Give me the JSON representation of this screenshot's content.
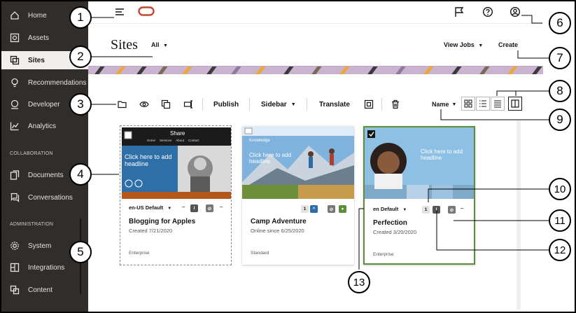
{
  "sidebar": {
    "items": [
      {
        "label": "Home",
        "icon": "home-icon"
      },
      {
        "label": "Assets",
        "icon": "assets-icon"
      },
      {
        "label": "Sites",
        "icon": "sites-icon"
      },
      {
        "label": "Recommendations",
        "icon": "lightbulb-icon"
      },
      {
        "label": "Developer",
        "icon": "developer-icon"
      },
      {
        "label": "Analytics",
        "icon": "analytics-icon"
      }
    ],
    "collaboration_label": "COLLABORATION",
    "collaboration_items": [
      {
        "label": "Documents",
        "icon": "documents-icon"
      },
      {
        "label": "Conversations",
        "icon": "conversations-icon"
      }
    ],
    "administration_label": "ADMINISTRATION",
    "administration_items": [
      {
        "label": "System",
        "icon": "gear-icon"
      },
      {
        "label": "Integrations",
        "icon": "integrations-icon"
      },
      {
        "label": "Content",
        "icon": "content-icon"
      }
    ]
  },
  "header": {
    "title": "Sites",
    "filter": "All",
    "view_jobs": "View Jobs",
    "create": "Create"
  },
  "toolbar": {
    "publish": "Publish",
    "sidebar": "Sidebar",
    "translate": "Translate",
    "sort": "Name"
  },
  "cards": [
    {
      "thumb_heading": "Share",
      "thumb_nav": [
        "Home",
        "Services",
        "About",
        "Contact"
      ],
      "thumb_headline": "Click here to add headline",
      "language": "en-US Default",
      "name": "Blogging for Apples",
      "meta": "Created 7/21/2020",
      "type": "Enterprise",
      "dash": "–"
    },
    {
      "thumb_heading": "Knowledge",
      "thumb_headline": "Click here to add headline",
      "language": "",
      "badge_count": "1",
      "name": "Camp Adventure",
      "meta": "Online since 6/25/2020",
      "type": "Standard"
    },
    {
      "thumb_headline": "Click here to add headline",
      "language": "en Default",
      "badge_count": "1",
      "name": "Perfection",
      "meta": "Created 3/20/2020",
      "type": "Enterprise",
      "dash": "–"
    }
  ],
  "callouts": [
    "1",
    "2",
    "3",
    "4",
    "5",
    "6",
    "7",
    "8",
    "9",
    "10",
    "11",
    "12",
    "13"
  ],
  "colors": {
    "sidebar_bg": "#312d2a",
    "brand_red": "#c74634",
    "selected_border": "#5d8e3b",
    "thumb_blue": "#2f6fa8"
  }
}
